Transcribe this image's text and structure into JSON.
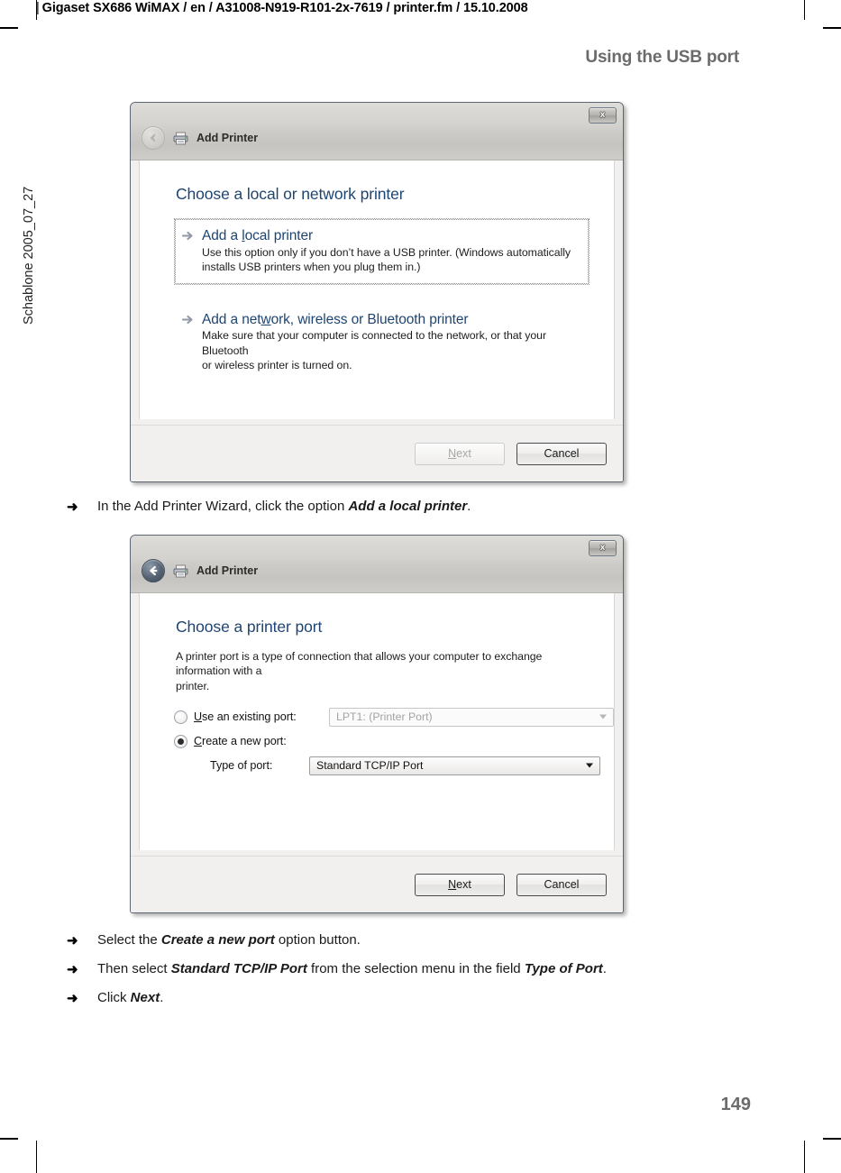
{
  "page": {
    "header_rule": "|",
    "header_text": "Gigaset SX686 WiMAX / en / A31008-N919-R101-2x-7619 / printer.fm / 15.10.2008",
    "chapter_title": "Using the USB port",
    "side_label": "Schablone 2005_07_27",
    "page_number": "149"
  },
  "dialog1": {
    "name": "add-printer-choose-type",
    "title": "Add Printer",
    "close_label": "x",
    "heading": "Choose a local or network printer",
    "options": [
      {
        "title_pre": "Add a ",
        "title_accel": "l",
        "title_post": "ocal printer",
        "title_full": "Add a local printer",
        "desc_line1": "Use this option only if you don’t have a USB printer. (Windows automatically",
        "desc_line2": "installs USB printers when you plug them in.)",
        "focused": true
      },
      {
        "title_pre": "Add a net",
        "title_accel": "w",
        "title_post": "ork, wireless or Bluetooth printer",
        "title_full": "Add a network, wireless or Bluetooth printer",
        "desc_line1": "Make sure that your computer is connected to the network, or that your Bluetooth",
        "desc_line2": "or wireless printer is turned on.",
        "focused": false
      }
    ],
    "buttons": {
      "next_accel": "N",
      "next_rest": "ext",
      "next_label": "Next",
      "next_enabled": false,
      "cancel_label": "Cancel"
    },
    "back_enabled": false
  },
  "dialog2": {
    "name": "add-printer-choose-port",
    "title": "Add Printer",
    "close_label": "x",
    "heading": "Choose a printer port",
    "description_line1": "A printer port is a type of connection that allows your computer to exchange information with a",
    "description_line2": "printer.",
    "existing_port": {
      "label_accel": "U",
      "label_rest": "se an existing port:",
      "label_full": "Use an existing port:",
      "selected": false,
      "value": "LPT1: (Printer Port)",
      "enabled": false
    },
    "new_port": {
      "label_accel": "C",
      "label_rest": "reate a new port:",
      "label_full": "Create a new port:",
      "selected": true
    },
    "type_of_port": {
      "label": "Type of port:",
      "value": "Standard TCP/IP Port",
      "enabled": true
    },
    "buttons": {
      "next_accel": "N",
      "next_rest": "ext",
      "next_label": "Next",
      "next_enabled": true,
      "cancel_label": "Cancel"
    },
    "back_enabled": true
  },
  "instructions": [
    {
      "bullet": "➜",
      "pre": "In the Add Printer Wizard, click the option ",
      "bold": "Add a local printer",
      "post": "."
    },
    {
      "bullet": "➜",
      "pre": "Select the ",
      "bold": "Create a new port",
      "post": " option button."
    },
    {
      "bullet": "➜",
      "pre": "Then select ",
      "bold": "Standard TCP/IP Port",
      "mid": " from the selection menu in the field ",
      "bold2": "Type of Port",
      "post": "."
    },
    {
      "bullet": "➜",
      "pre": "Click ",
      "bold": "Next",
      "post": "."
    }
  ],
  "colors": {
    "heading_blue": "#1e4572",
    "chapter_gray": "#6b6b6b",
    "dialog_bg": "#f1f0ef"
  }
}
